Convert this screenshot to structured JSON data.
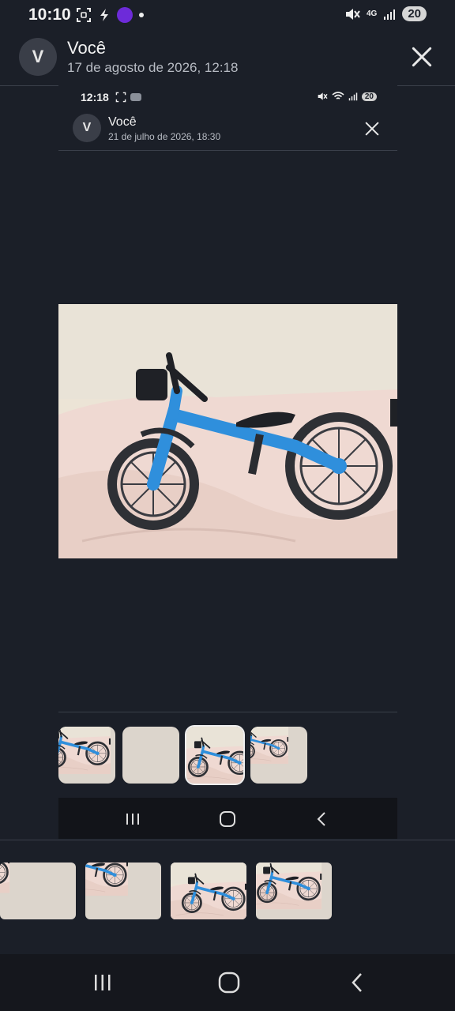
{
  "status": {
    "time": "10:10",
    "network": "4G",
    "battery": "20"
  },
  "header": {
    "avatar_letter": "V",
    "title": "Você",
    "subtitle": "17 de agosto de 2026, 12:18"
  },
  "inner": {
    "status": {
      "time": "12:18",
      "battery": "20"
    },
    "header": {
      "avatar_letter": "V",
      "title": "Você",
      "subtitle": "21 de julho de 2026, 18:30"
    }
  },
  "colors": {
    "background": "#1b1f28",
    "bike_blue": "#2f8fdc",
    "wall": "#ece4d6",
    "blanket": "#efd9d2"
  },
  "icons": [
    "close-icon",
    "back-icon",
    "home-icon",
    "recents-icon"
  ]
}
